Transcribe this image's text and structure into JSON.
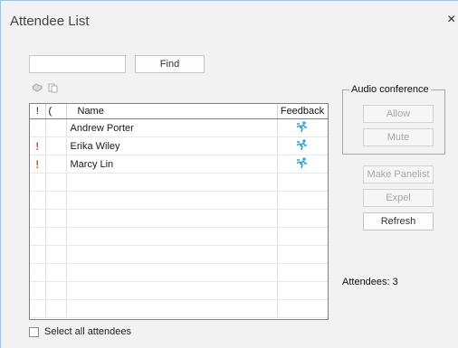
{
  "window": {
    "title": "Attendee List",
    "close_glyph": "×"
  },
  "search": {
    "value": "",
    "placeholder": "",
    "find_label": "Find"
  },
  "toolbar": {
    "icons": [
      "hand-icon",
      "copy-icon"
    ]
  },
  "grid": {
    "columns": {
      "flag": "!",
      "status": "(",
      "name": "Name",
      "feedback": "Feedback"
    },
    "rows": [
      {
        "flag": "",
        "name": "Andrew Porter",
        "feedback_icon": "running-person-icon"
      },
      {
        "flag": "!",
        "name": "Erika Wiley",
        "feedback_icon": "running-person-icon"
      },
      {
        "flag": "!",
        "name": "Marcy Lin",
        "feedback_icon": "running-person-icon"
      }
    ]
  },
  "footer": {
    "select_all_label": "Select all attendees"
  },
  "audio_conference": {
    "legend": "Audio conference",
    "allow_label": "Allow",
    "mute_label": "Mute"
  },
  "actions": {
    "make_panelist_label": "Make Panelist",
    "expel_label": "Expel",
    "refresh_label": "Refresh"
  },
  "status": {
    "attendees_text": "Attendees: 3"
  },
  "colors": {
    "accent_flag": "#e8560c",
    "feedback_icon": "#1ea0e0",
    "window_border": "#9fbfe3"
  }
}
